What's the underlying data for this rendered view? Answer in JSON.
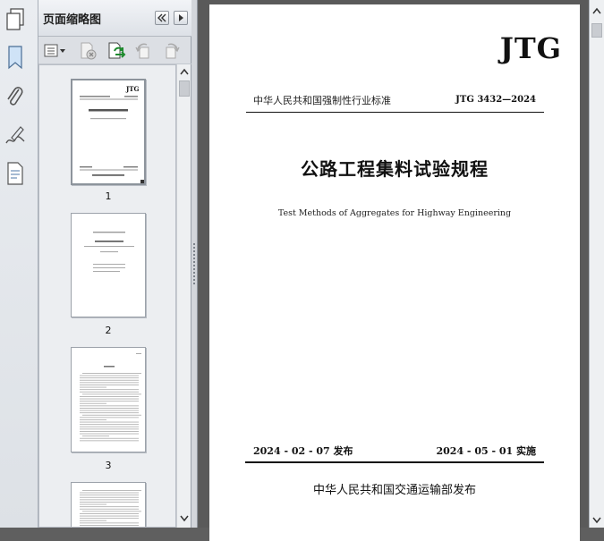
{
  "panel": {
    "title": "页面缩略图"
  },
  "thumbnails": [
    {
      "page": "1"
    },
    {
      "page": "2"
    },
    {
      "page": "3"
    }
  ],
  "page1": {
    "logo": "JTG",
    "standard_category": "中华人民共和国强制性行业标准",
    "standard_code": "JTG 3432—2024",
    "title_cn": "公路工程集料试验规程",
    "title_en": "Test Methods of Aggregates for Highway Engineering",
    "release_date": "2024 - 02 - 07 发布",
    "effective_date": "2024 - 05 - 01 实施",
    "issuer": "中华人民共和国交通运输部发布"
  },
  "icons": {
    "leftbar": [
      "pages-panel-icon",
      "bookmark-icon",
      "attachment-icon",
      "signature-icon",
      "page-layers-icon"
    ],
    "panel_toolbar": [
      "options-menu-icon",
      "delete-page-icon",
      "insert-pages-icon",
      "rotate-ccw-icon",
      "rotate-cw-icon"
    ]
  }
}
